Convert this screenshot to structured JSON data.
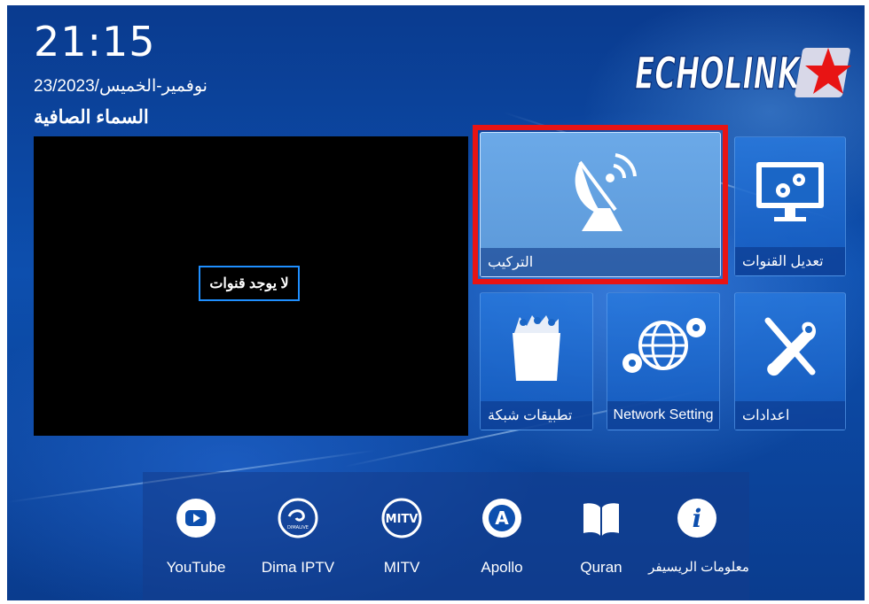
{
  "header": {
    "clock": "21:15",
    "date": "23/2023/نوفمير-الخميس",
    "satellite": "السماء الصافية"
  },
  "brand": {
    "logo_text": "ECHOLINK"
  },
  "preview": {
    "message": "لا يوجد قنوات"
  },
  "tiles": [
    {
      "id": "installation",
      "label": "التركيب",
      "icon": "satellite-dish-icon",
      "selected": true
    },
    {
      "id": "edit-channels",
      "label": "تعديل القنوات",
      "icon": "monitor-gears-icon"
    },
    {
      "id": "network-apps",
      "label": "تطبيقات شبكة",
      "icon": "apps-basket-icon"
    },
    {
      "id": "network-setting",
      "label": "Network Setting",
      "icon": "globe-gears-icon"
    },
    {
      "id": "settings",
      "label": "اعدادات",
      "icon": "tools-icon"
    }
  ],
  "apps": [
    {
      "label": "YouTube",
      "icon": "youtube-icon"
    },
    {
      "label": "Dima IPTV",
      "icon": "dima-iptv-icon",
      "icon_text": "DIMALIVE"
    },
    {
      "label": "MITV",
      "icon": "mitv-icon",
      "icon_text": "MITV"
    },
    {
      "label": "Apollo",
      "icon": "apollo-icon",
      "icon_text": "A"
    },
    {
      "label": "Quran",
      "icon": "quran-book-icon"
    },
    {
      "label": "معلومات الريسيفر",
      "icon": "info-icon",
      "icon_text": "i"
    }
  ],
  "colors": {
    "selection": "#e81414",
    "accent": "#1f8fff",
    "background": "#0d4fae"
  }
}
